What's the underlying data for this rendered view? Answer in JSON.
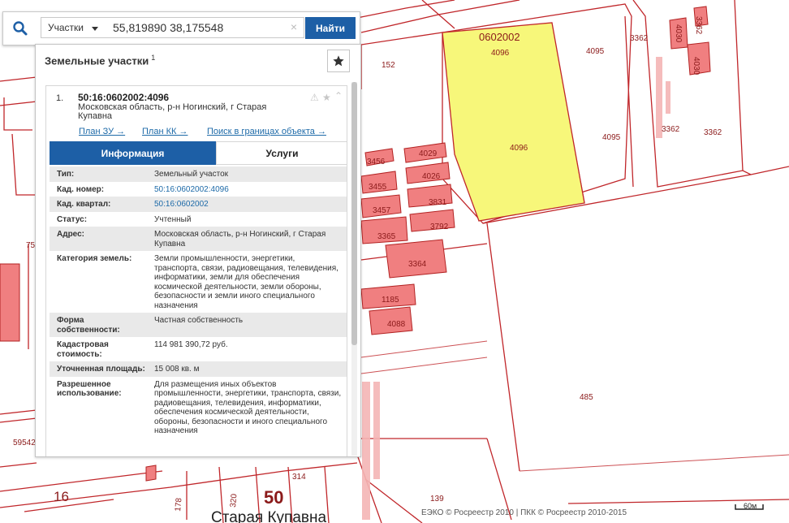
{
  "search": {
    "layer_label": "Участки",
    "query": "55,819890 38,175548",
    "find_label": "Найти",
    "clear_symbol": "×"
  },
  "panel": {
    "title": "Земельные участки",
    "count": "1",
    "favorite_icon": "star-icon"
  },
  "result": {
    "number": "1.",
    "cad_number": "50:16:0602002:4096",
    "address": "Московская область, р-н Ногинский, г Старая Купавна",
    "icons": [
      "warning-icon",
      "star-icon",
      "chevron-up-icon"
    ],
    "links": [
      "План ЗУ →",
      "План КК →",
      "Поиск в границах объекта →"
    ]
  },
  "tabs": {
    "info": "Информация",
    "services": "Услуги"
  },
  "details": [
    {
      "label": "Тип:",
      "value": "Земельный участок",
      "link": false
    },
    {
      "label": "Кад. номер:",
      "value": "50:16:0602002:4096",
      "link": true
    },
    {
      "label": "Кад. квартал:",
      "value": "50:16:0602002",
      "link": true
    },
    {
      "label": "Статус:",
      "value": "Учтенный",
      "link": false
    },
    {
      "label": "Адрес:",
      "value": "Московская область, р-н Ногинский, г Старая Купавна",
      "link": false
    },
    {
      "label": "Категория земель:",
      "value": "Земли промышленности, энергетики, транспорта, связи, радиовещания, телевидения, информатики, земли для обеспечения космической деятельности, земли обороны, безопасности и земли иного специального назначения",
      "link": false
    },
    {
      "label": "Форма собственности:",
      "value": "Частная собственность",
      "link": false
    },
    {
      "label": "Кадастровая стоимость:",
      "value": "114 981 390,72 руб.",
      "link": false
    },
    {
      "label": "Уточненная площадь:",
      "value": "15 008 кв. м",
      "link": false
    },
    {
      "label": "Разрешенное использование:",
      "value": "Для размещения иных объектов промышленности, энергетики, транспорта, связи, радиовещания, телевидения, информатики, обеспечения космической деятельности, обороны, безопасности и иного специального назначения",
      "link": false
    }
  ],
  "map": {
    "parcel_labels": [
      "0602002",
      "4096",
      "4096",
      "4095",
      "4095",
      "3362",
      "3362",
      "3362",
      "3362",
      "4030",
      "4030",
      "152",
      "3456",
      "4029",
      "3455",
      "4026",
      "3457",
      "3831",
      "3365",
      "3792",
      "3364",
      "1185",
      "4088",
      "485",
      "139",
      "314",
      "16",
      "50",
      "320",
      "178",
      "75",
      "59542"
    ],
    "place_name": "Старая Купавна",
    "highlight_color": "#f7f77a",
    "building_color": "#f07f80",
    "boundary_color": "#b22222",
    "scale_label": "60м",
    "copyright": "ЕЭКО © Росреестр 2010 | ПКК © Росреестр 2010-2015"
  }
}
